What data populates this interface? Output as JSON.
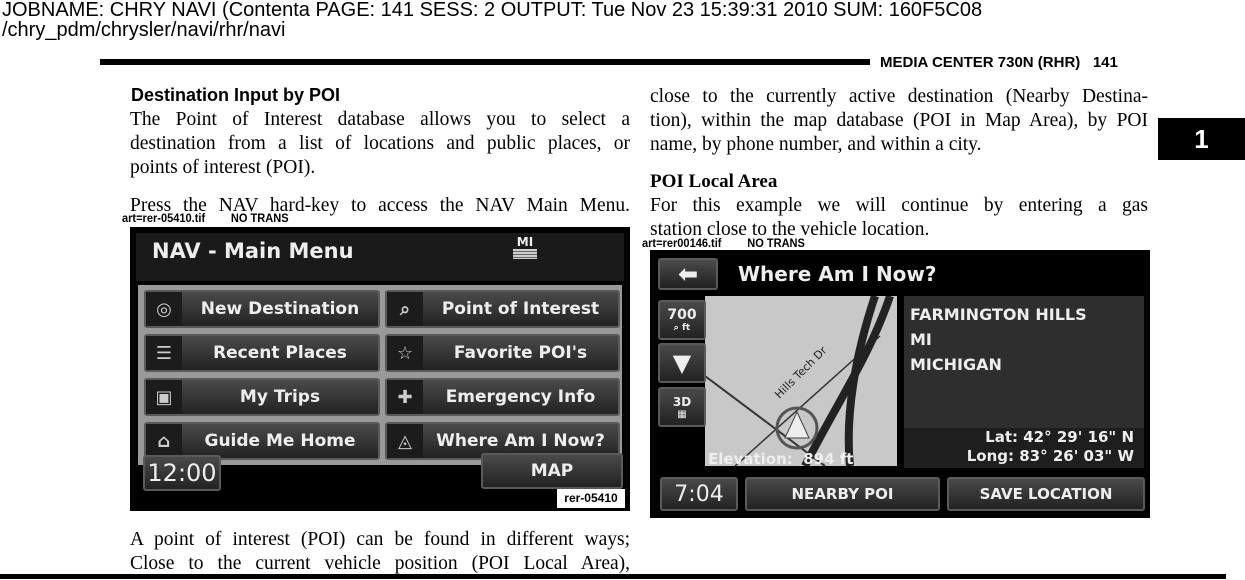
{
  "job_header": {
    "line1": "JOBNAME: CHRY NAVI (Contenta   PAGE: 141  SESS: 2  OUTPUT: Tue Nov 23 15:39:31 2010  SUM: 160F5C08",
    "line2": "/chry_pdm/chrysler/navi/rhr/navi"
  },
  "running_head": {
    "title": "MEDIA CENTER 730N (RHR)",
    "page": "141"
  },
  "chapter_tab": "1",
  "left": {
    "heading": "Destination Input by POI",
    "para1": [
      "The Point of Interest database allows you to select a",
      "destination from a list of locations and public places, or",
      "points of interest (POI)."
    ],
    "para2": "Press the NAV hard-key to access the NAV Main Menu.",
    "caption": {
      "file": "art=rer-05410.tif",
      "note": "NO TRANS"
    },
    "para3": [
      "A point of interest (POI) can be found in different ways;",
      "Close to the current vehicle position (POI Local Area),"
    ]
  },
  "right": {
    "para1": [
      "close to the currently active destination (Nearby Destina-",
      "tion), within the map database (POI in Map Area), by POI",
      "name, by phone number, and within a city."
    ],
    "heading": "POI Local Area",
    "para2": [
      "For this example we will continue by entering a gas",
      "station close to the vehicle location."
    ],
    "caption": {
      "file": "art=rer00146.tif",
      "note": "NO TRANS"
    }
  },
  "screen1": {
    "title": "NAV - Main Menu",
    "state": "MI",
    "buttons": [
      {
        "label": "New Destination",
        "icon": "target-icon"
      },
      {
        "label": "Point of Interest",
        "icon": "poi-search-icon"
      },
      {
        "label": "Recent Places",
        "icon": "list-icon"
      },
      {
        "label": "Favorite POI's",
        "icon": "star-icon"
      },
      {
        "label": "My Trips",
        "icon": "suitcase-icon"
      },
      {
        "label": "Emergency Info",
        "icon": "cross-icon"
      },
      {
        "label": "Guide Me Home",
        "icon": "home-icon"
      },
      {
        "label": "Where Am I Now?",
        "icon": "location-arrow-icon"
      }
    ],
    "time": "12:00",
    "map": "MAP",
    "art_id": "rer-05410"
  },
  "screen2": {
    "title": "Where Am I Now?",
    "scale": "700",
    "scale_unit": "ft",
    "view_mode": "3D",
    "street": "Hills Tech Dr",
    "city": "FARMINGTON HILLS",
    "state": "MI",
    "state_full": "MICHIGAN",
    "elevation_label": "Elevation:",
    "elevation": "894 ft",
    "lat": "Lat: 42° 29' 16\" N",
    "long": "Long: 83° 26' 03\" W",
    "time": "7:04",
    "nearby": "NEARBY POI",
    "save": "SAVE LOCATION"
  }
}
